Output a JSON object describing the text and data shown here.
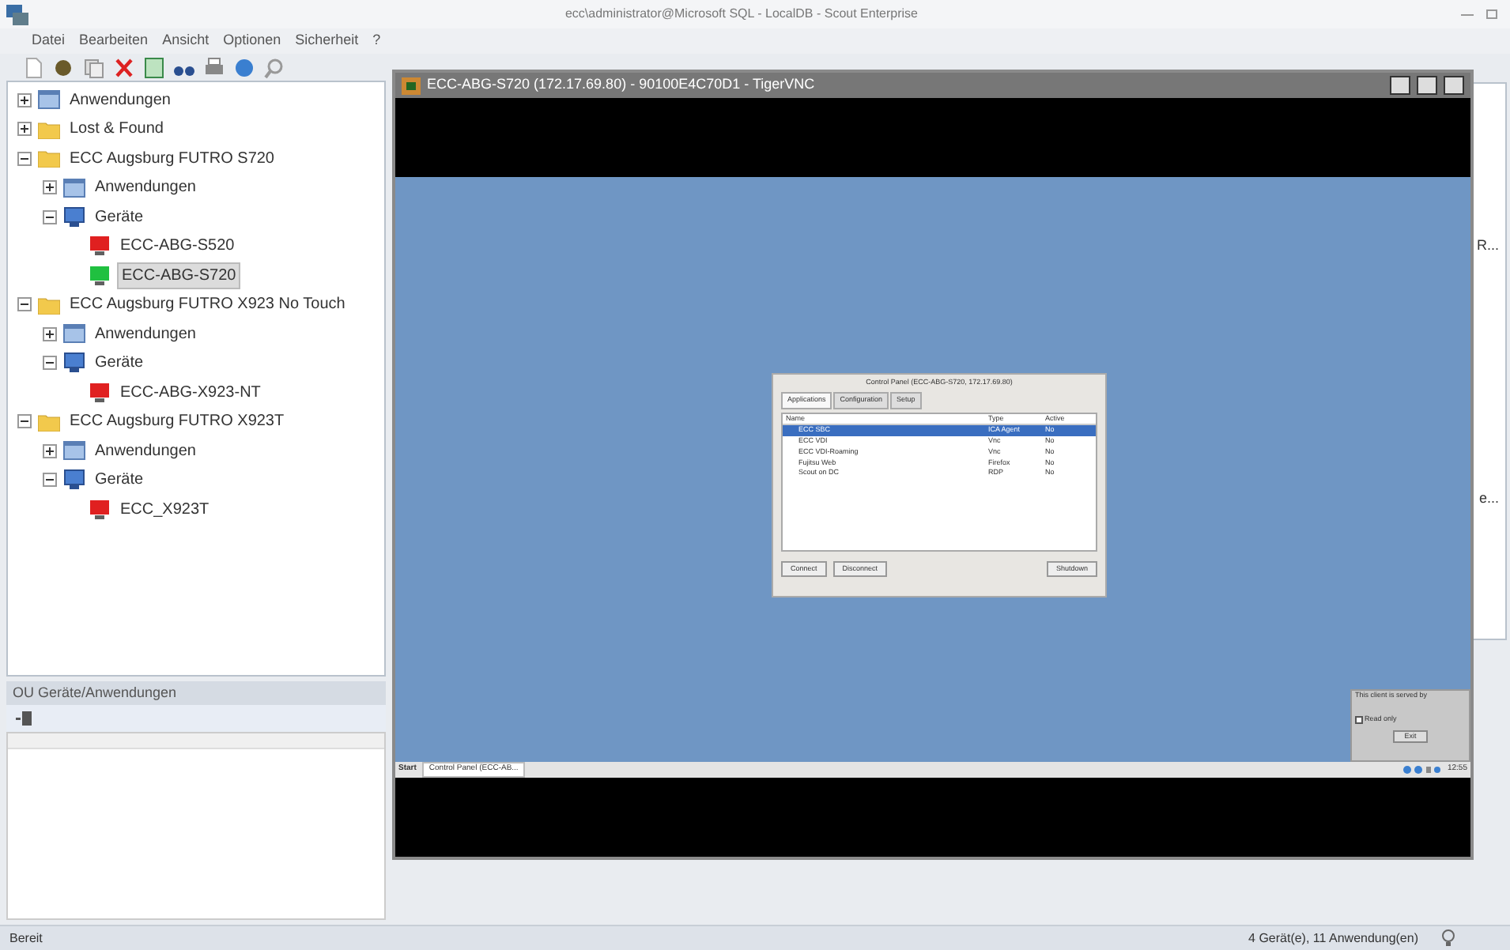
{
  "window": {
    "title": "ecc\\administrator@Microsoft SQL - LocalDB - Scout Enterprise"
  },
  "menu": [
    "Datei",
    "Bearbeiten",
    "Ansicht",
    "Optionen",
    "Sicherheit",
    "?"
  ],
  "tree": [
    {
      "label": "Anwendungen",
      "kind": "apps",
      "expanded": false,
      "selected": false
    },
    {
      "label": "Lost & Found",
      "kind": "folder",
      "expanded": false,
      "selected": false
    },
    {
      "label": "ECC Augsburg FUTRO S720",
      "kind": "folder",
      "expanded": true,
      "selected": false,
      "children": [
        {
          "label": "Anwendungen",
          "kind": "apps",
          "expanded": false,
          "selected": false
        },
        {
          "label": "Geräte",
          "kind": "devices",
          "expanded": true,
          "selected": false,
          "children": [
            {
              "label": "ECC-ABG-S520",
              "kind": "device",
              "color": "#e02020",
              "selected": false
            },
            {
              "label": "ECC-ABG-S720",
              "kind": "device",
              "color": "#20c040",
              "selected": true
            }
          ]
        }
      ]
    },
    {
      "label": "ECC Augsburg FUTRO X923 No Touch",
      "kind": "folder",
      "expanded": true,
      "selected": false,
      "children": [
        {
          "label": "Anwendungen",
          "kind": "apps",
          "expanded": false,
          "selected": false
        },
        {
          "label": "Geräte",
          "kind": "devices",
          "expanded": true,
          "selected": false,
          "children": [
            {
              "label": "ECC-ABG-X923-NT",
              "kind": "device",
              "color": "#e02020",
              "selected": false
            }
          ]
        }
      ]
    },
    {
      "label": "ECC Augsburg FUTRO X923T",
      "kind": "folder",
      "expanded": true,
      "selected": false,
      "children": [
        {
          "label": "Anwendungen",
          "kind": "apps",
          "expanded": false,
          "selected": false
        },
        {
          "label": "Geräte",
          "kind": "devices",
          "expanded": true,
          "selected": false,
          "children": [
            {
              "label": "ECC_X923T",
              "kind": "device",
              "color": "#e02020",
              "selected": false
            }
          ]
        }
      ]
    }
  ],
  "ou_panel": {
    "title": "OU Geräte/Anwendungen"
  },
  "right_panel": {
    "column_1": "R...",
    "column_2": "e..."
  },
  "vnc": {
    "title": "ECC-ABG-S720 (172.17.69.80) - 90100E4C70D1 - TigerVNC",
    "dialog": {
      "title": "Control Panel (ECC-ABG-S720, 172.17.69.80)",
      "tabs": [
        {
          "label": "Applications",
          "selected": true
        },
        {
          "label": "Configuration",
          "selected": false
        },
        {
          "label": "Setup",
          "selected": false
        }
      ],
      "columns": [
        "Name",
        "Type",
        "Active"
      ],
      "rows": [
        {
          "cells": [
            "ECC SBC",
            "ICA Agent",
            "No"
          ],
          "selected": true
        },
        {
          "cells": [
            "ECC VDI",
            "Vnc",
            "No"
          ],
          "selected": false
        },
        {
          "cells": [
            "ECC VDI-Roaming",
            "Vnc",
            "No"
          ],
          "selected": false
        },
        {
          "cells": [
            "Fujitsu Web",
            "Firefox",
            "No"
          ],
          "selected": false
        },
        {
          "cells": [
            "Scout on DC",
            "RDP",
            "No"
          ],
          "selected": false
        }
      ],
      "buttons": [
        "Connect",
        "Disconnect",
        "Shutdown"
      ]
    },
    "info": {
      "text": "This client is served by",
      "read_only": {
        "label": "Read only",
        "checked": false
      },
      "button": "Exit"
    },
    "taskbar": {
      "start": "Start",
      "task": "Control Panel (ECC-AB...",
      "clock": "12:55"
    }
  },
  "status_bar": {
    "left": "Bereit",
    "right": "4 Gerät(e), 11 Anwendung(en)"
  }
}
